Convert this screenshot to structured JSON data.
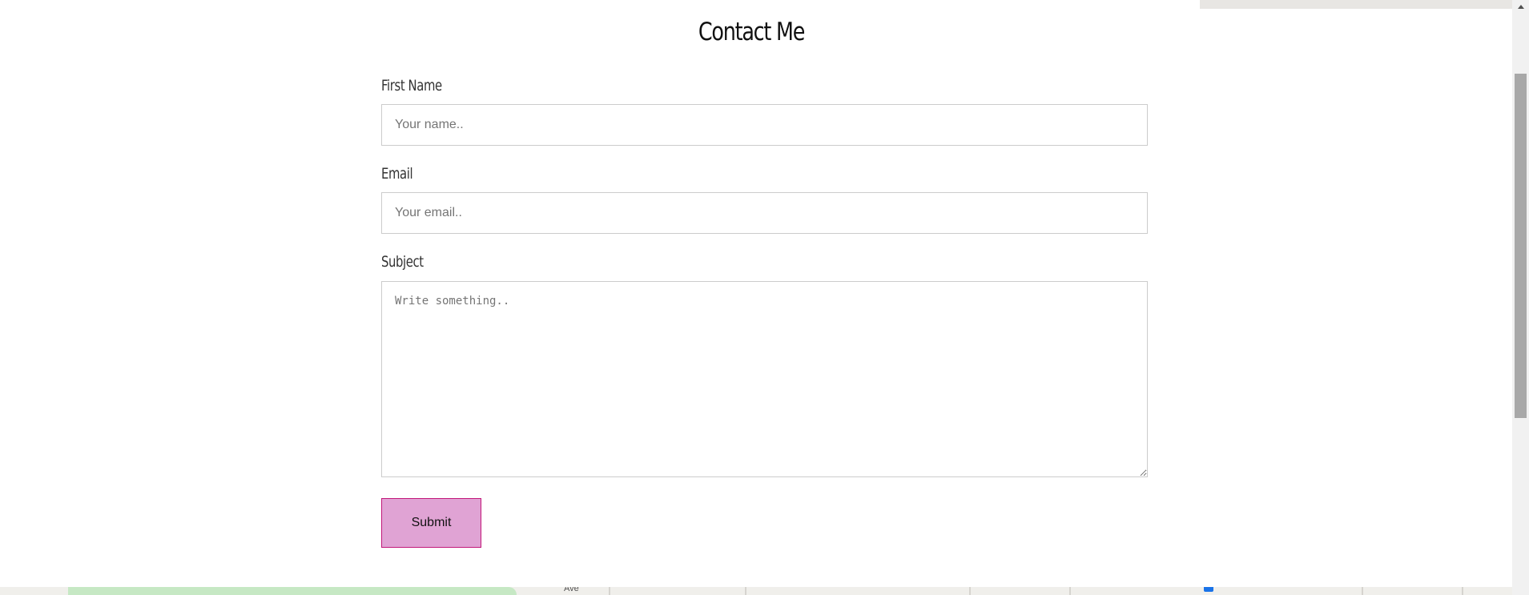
{
  "contact_form": {
    "title": "Contact Me",
    "first_name_label": "First Name",
    "first_name_placeholder": "Your name..",
    "email_label": "Email",
    "email_placeholder": "Your email..",
    "subject_label": "Subject",
    "subject_placeholder": "Write something..",
    "submit_label": "Submit"
  },
  "map": {
    "street_fragment": "Ave"
  },
  "colors": {
    "submit_background": "#e0a3d4",
    "submit_border": "#c2187a",
    "input_border": "#cccccc"
  }
}
